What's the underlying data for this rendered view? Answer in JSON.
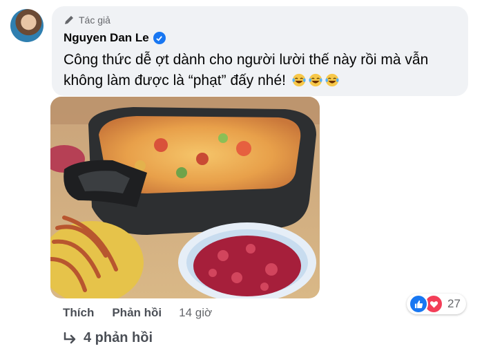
{
  "comment": {
    "author_badge": "Tác giả",
    "author_name": "Nguyen Dan Le",
    "text": "Công thức dễ ợt dành cho người lười thế này rồi mà vẫn không làm được là “phạt” đấy nhé!",
    "emoji_count": 3,
    "emoji_icon": "laughing-tears-emoji"
  },
  "actions": {
    "like_label": "Thích",
    "reply_label": "Phản hồi",
    "timestamp": "14 giờ"
  },
  "reactions": {
    "types": [
      "like",
      "love"
    ],
    "count": "27",
    "colors": {
      "like": "#1877f2",
      "love": "#f33e58"
    }
  },
  "replies": {
    "label": "4 phản hồi"
  }
}
